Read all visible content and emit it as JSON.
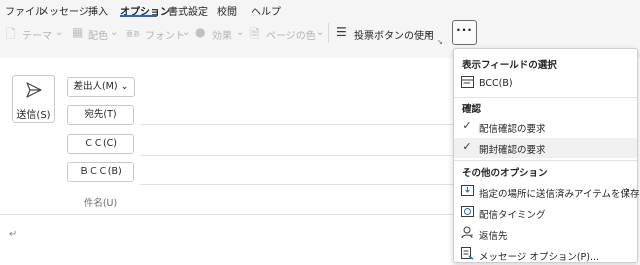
{
  "menu": {
    "tabs": [
      {
        "label": "ファイル"
      },
      {
        "label": "メッセージ"
      },
      {
        "label": "挿入"
      },
      {
        "label": "オプション"
      },
      {
        "label": "書式設定"
      },
      {
        "label": "校閲"
      },
      {
        "label": "ヘルプ"
      }
    ],
    "active_tab": "オプション"
  },
  "ribbon": {
    "theme_label": "テーマ",
    "colors_label": "配色",
    "fonts_prefix": "亜あ",
    "fonts_label": "フォント",
    "effects_label": "効果",
    "page_color_label": "ページの色",
    "voting_label": "投票ボタンの使用",
    "more_label": "···",
    "dropdown_chevron": "⌄"
  },
  "compose": {
    "send_label": "送信(S)",
    "from_label": "差出人(M)",
    "to_label": "宛先(T)",
    "cc_label": "ＣＣ(C)",
    "bcc_label": "ＢＣＣ(B)",
    "subject_label": "件名(U)",
    "return_mark": "↵"
  },
  "dropdown": {
    "section_show_fields": "表示フィールドの選択",
    "bcc_item": "BCC(B)",
    "section_tracking": "確認",
    "delivery_receipt": "配信確認の要求",
    "read_receipt": "開封確認の要求",
    "section_more_options": "その他のオプション",
    "save_sent_item": "指定の場所に送信済みアイテムを保存(S)",
    "delay_delivery": "配信タイミング",
    "reply_to": "返信先",
    "message_options": "メッセージ オプション(P)..."
  },
  "colors": {
    "accent": "#2b66c4",
    "hover": "#f0f0f0"
  }
}
